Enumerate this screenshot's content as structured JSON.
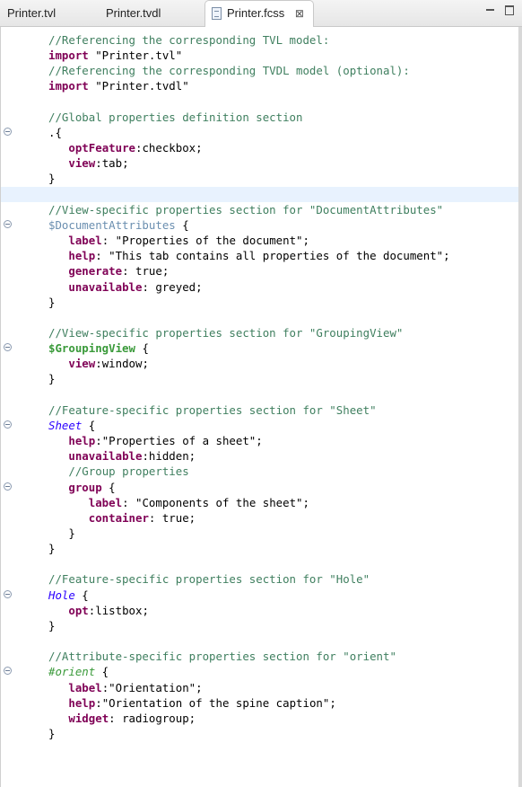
{
  "tabs": [
    {
      "label": "Printer.tvl",
      "active": false
    },
    {
      "label": "Printer.tvdl",
      "active": false
    },
    {
      "label": "Printer.fcss",
      "active": true,
      "close_glyph": "⊠"
    }
  ],
  "window_controls": {
    "minimize": "minimize-icon",
    "maximize": "maximize-icon"
  },
  "code_lines": [
    {
      "indent": "",
      "parts": [
        {
          "t": "//Referencing the corresponding TVL model:",
          "c": "cm"
        }
      ]
    },
    {
      "indent": "",
      "parts": [
        {
          "t": "import",
          "c": "kw"
        },
        {
          "t": " \"Printer.tvl\"",
          "c": "str"
        }
      ]
    },
    {
      "indent": "",
      "parts": [
        {
          "t": "//Referencing the corresponding TVDL model (optional):",
          "c": "cm"
        }
      ]
    },
    {
      "indent": "",
      "parts": [
        {
          "t": "import",
          "c": "kw"
        },
        {
          "t": " \"Printer.tvdl\"",
          "c": "str"
        }
      ]
    },
    {
      "indent": "",
      "parts": []
    },
    {
      "indent": "",
      "parts": [
        {
          "t": "//Global properties definition section",
          "c": "cm"
        }
      ]
    },
    {
      "indent": "",
      "fold": true,
      "outdent": true,
      "parts": [
        {
          "t": ".{",
          "c": "plain"
        }
      ]
    },
    {
      "indent": "   ",
      "parts": [
        {
          "t": "optFeature",
          "c": "prop"
        },
        {
          "t": ":checkbox;",
          "c": "plain"
        }
      ]
    },
    {
      "indent": "   ",
      "parts": [
        {
          "t": "view",
          "c": "prop"
        },
        {
          "t": ":tab;",
          "c": "plain"
        }
      ]
    },
    {
      "indent": "",
      "parts": [
        {
          "t": "}",
          "c": "plain"
        }
      ]
    },
    {
      "indent": "",
      "hl": true,
      "parts": []
    },
    {
      "indent": "",
      "parts": [
        {
          "t": "//View-specific properties section for \"DocumentAttributes\"",
          "c": "cm"
        }
      ]
    },
    {
      "indent": "",
      "fold": true,
      "outdent": true,
      "parts": [
        {
          "t": "$DocumentAttributes",
          "c": "sel-id"
        },
        {
          "t": " {",
          "c": "plain"
        }
      ]
    },
    {
      "indent": "   ",
      "parts": [
        {
          "t": "label",
          "c": "prop"
        },
        {
          "t": ": \"Properties of the document\";",
          "c": "plain"
        }
      ]
    },
    {
      "indent": "   ",
      "parts": [
        {
          "t": "help",
          "c": "prop"
        },
        {
          "t": ": \"This tab contains all properties of the document\";",
          "c": "plain"
        }
      ]
    },
    {
      "indent": "   ",
      "parts": [
        {
          "t": "generate",
          "c": "prop"
        },
        {
          "t": ": true;",
          "c": "plain"
        }
      ]
    },
    {
      "indent": "   ",
      "parts": [
        {
          "t": "unavailable",
          "c": "prop"
        },
        {
          "t": ": greyed;",
          "c": "plain"
        }
      ]
    },
    {
      "indent": "",
      "parts": [
        {
          "t": "}",
          "c": "plain"
        }
      ]
    },
    {
      "indent": "",
      "parts": []
    },
    {
      "indent": "",
      "parts": [
        {
          "t": "//View-specific properties section for \"GroupingView\"",
          "c": "cm"
        }
      ]
    },
    {
      "indent": "",
      "fold": true,
      "outdent": true,
      "parts": [
        {
          "t": "$GroupingView",
          "c": "sel-id-g"
        },
        {
          "t": " {",
          "c": "plain"
        }
      ]
    },
    {
      "indent": "   ",
      "parts": [
        {
          "t": "view",
          "c": "prop"
        },
        {
          "t": ":window;",
          "c": "plain"
        }
      ]
    },
    {
      "indent": "",
      "parts": [
        {
          "t": "}",
          "c": "plain"
        }
      ]
    },
    {
      "indent": "",
      "parts": []
    },
    {
      "indent": "",
      "parts": [
        {
          "t": "//Feature-specific properties section for \"Sheet\"",
          "c": "cm"
        }
      ]
    },
    {
      "indent": "",
      "fold": true,
      "outdent": true,
      "parts": [
        {
          "t": "Sheet",
          "c": "sel-feat"
        },
        {
          "t": " {",
          "c": "plain"
        }
      ]
    },
    {
      "indent": "   ",
      "parts": [
        {
          "t": "help",
          "c": "prop"
        },
        {
          "t": ":\"Properties of a sheet\";",
          "c": "plain"
        }
      ]
    },
    {
      "indent": "   ",
      "parts": [
        {
          "t": "unavailable",
          "c": "prop"
        },
        {
          "t": ":hidden;",
          "c": "plain"
        }
      ]
    },
    {
      "indent": "   ",
      "parts": [
        {
          "t": "//Group properties",
          "c": "cm"
        }
      ]
    },
    {
      "indent": "   ",
      "fold": true,
      "parts": [
        {
          "t": "group",
          "c": "prop"
        },
        {
          "t": " {",
          "c": "plain"
        }
      ]
    },
    {
      "indent": "      ",
      "parts": [
        {
          "t": "label",
          "c": "prop"
        },
        {
          "t": ": \"Components of the sheet\";",
          "c": "plain"
        }
      ]
    },
    {
      "indent": "      ",
      "parts": [
        {
          "t": "container",
          "c": "prop"
        },
        {
          "t": ": true;",
          "c": "plain"
        }
      ]
    },
    {
      "indent": "   ",
      "parts": [
        {
          "t": "}",
          "c": "plain"
        }
      ]
    },
    {
      "indent": "",
      "parts": [
        {
          "t": "}",
          "c": "plain"
        }
      ]
    },
    {
      "indent": "",
      "parts": []
    },
    {
      "indent": "",
      "parts": [
        {
          "t": "//Feature-specific properties section for \"Hole\"",
          "c": "cm"
        }
      ]
    },
    {
      "indent": "",
      "fold": true,
      "outdent": true,
      "parts": [
        {
          "t": "Hole",
          "c": "sel-feat"
        },
        {
          "t": " {",
          "c": "plain"
        }
      ]
    },
    {
      "indent": "   ",
      "parts": [
        {
          "t": "opt",
          "c": "prop"
        },
        {
          "t": ":listbox;",
          "c": "plain"
        }
      ]
    },
    {
      "indent": "",
      "parts": [
        {
          "t": "}",
          "c": "plain"
        }
      ]
    },
    {
      "indent": "",
      "parts": []
    },
    {
      "indent": "",
      "parts": [
        {
          "t": "//Attribute-specific properties section for \"orient\"",
          "c": "cm"
        }
      ]
    },
    {
      "indent": "",
      "fold": true,
      "outdent": true,
      "parts": [
        {
          "t": "#orient",
          "c": "sel-attr"
        },
        {
          "t": " {",
          "c": "plain"
        }
      ]
    },
    {
      "indent": "   ",
      "parts": [
        {
          "t": "label",
          "c": "prop"
        },
        {
          "t": ":\"Orientation\";",
          "c": "plain"
        }
      ]
    },
    {
      "indent": "   ",
      "parts": [
        {
          "t": "help",
          "c": "prop"
        },
        {
          "t": ":\"Orientation of the spine caption\";",
          "c": "plain"
        }
      ]
    },
    {
      "indent": "   ",
      "parts": [
        {
          "t": "widget",
          "c": "prop"
        },
        {
          "t": ": radiogroup;",
          "c": "plain"
        }
      ]
    },
    {
      "indent": "",
      "parts": [
        {
          "t": "}",
          "c": "plain"
        }
      ]
    }
  ]
}
